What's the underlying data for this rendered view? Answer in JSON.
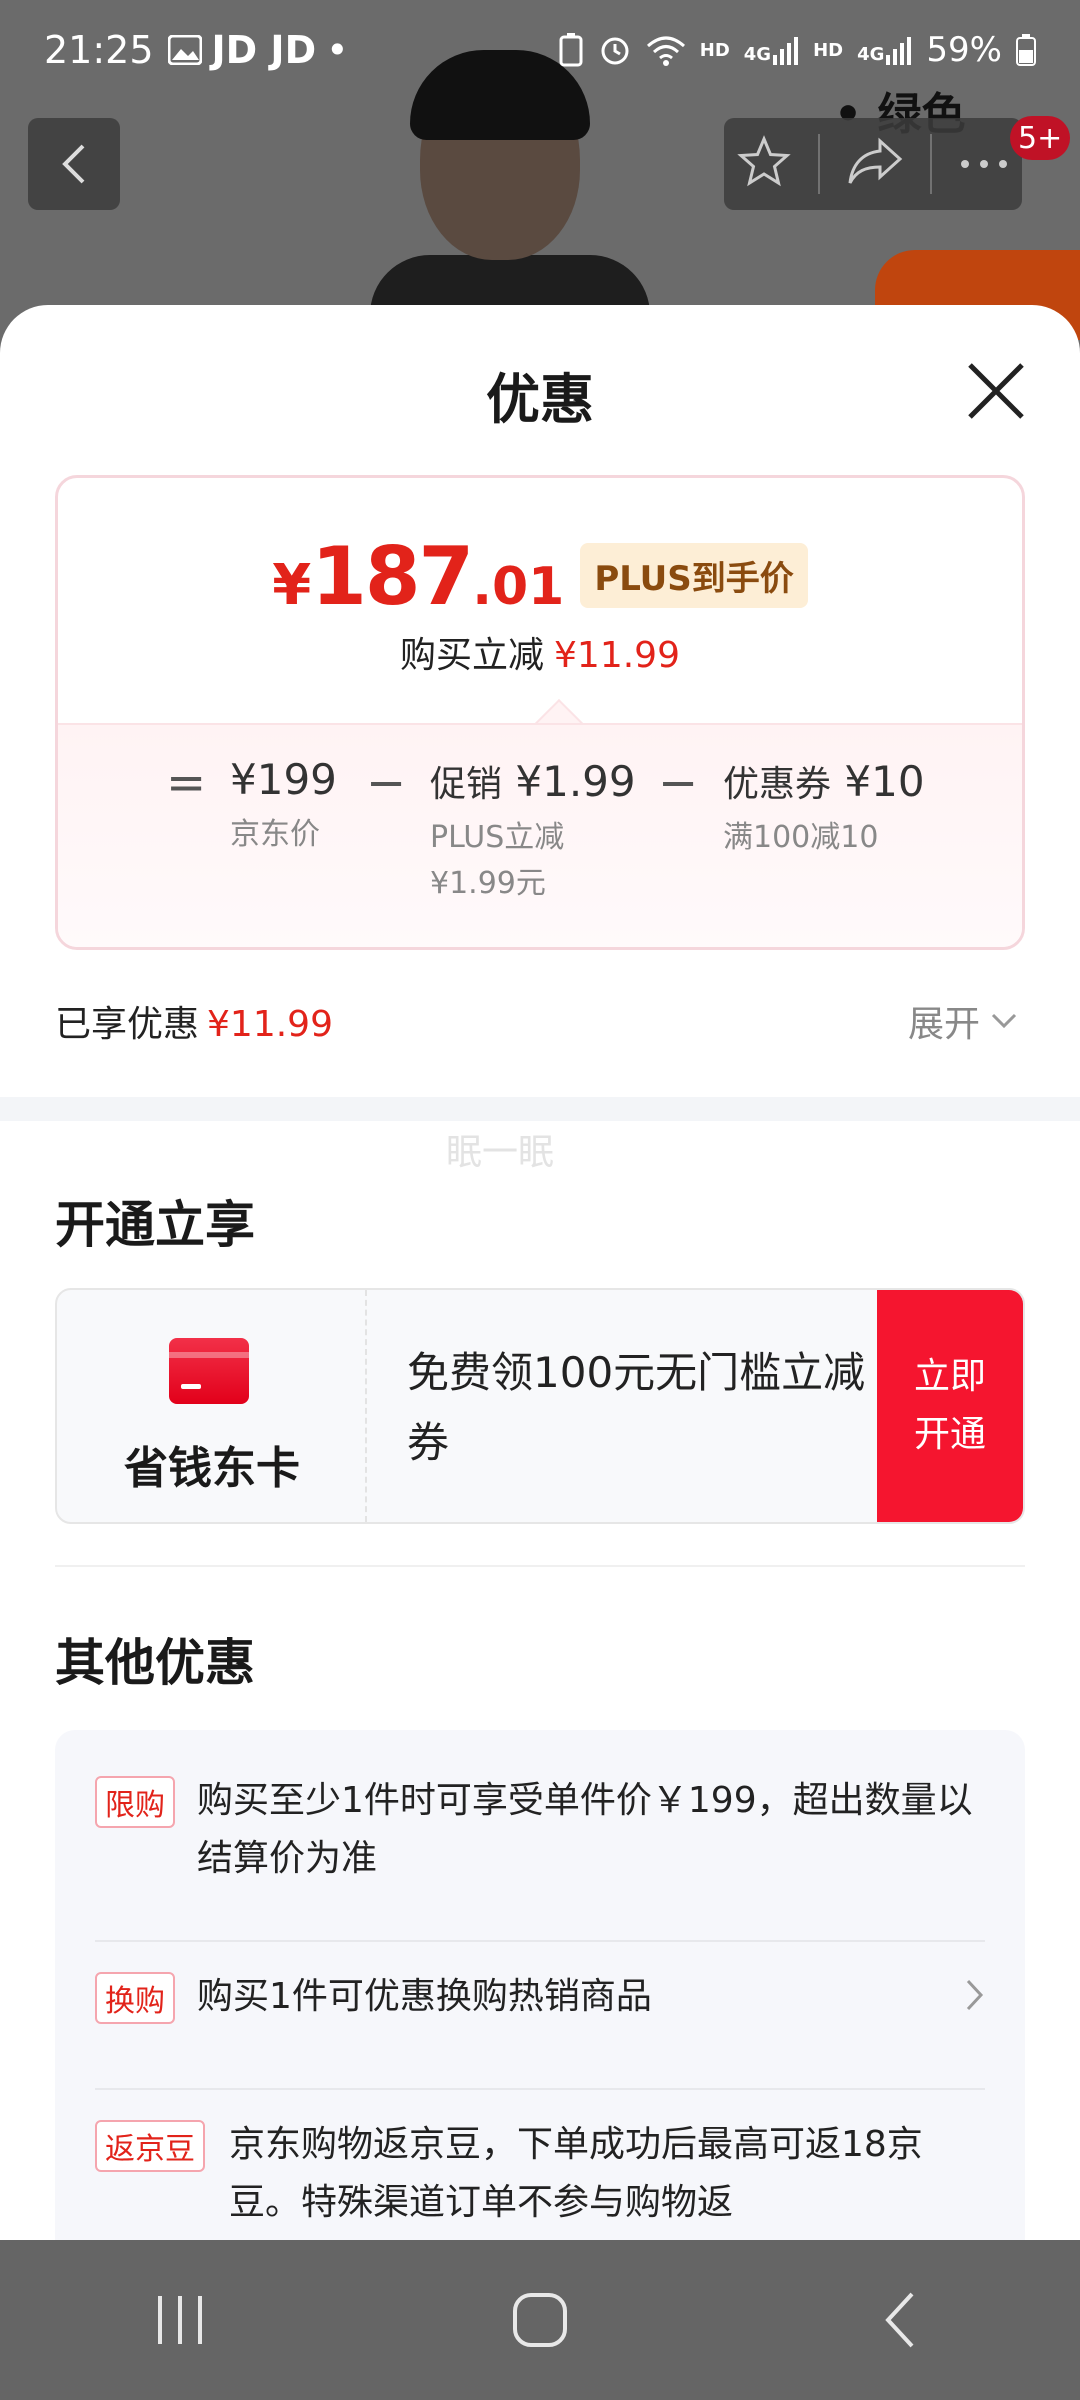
{
  "status_bar": {
    "time": "21:25",
    "notif_text": "JD JD",
    "dot": "•",
    "hd1": "HD",
    "sig1": "4G",
    "hd2": "HD",
    "sig2": "4G",
    "battery": "59%"
  },
  "background": {
    "variant_label": "• 绿色",
    "cart_badge": "5+"
  },
  "sheet": {
    "title": "优惠",
    "price": {
      "currency": "¥",
      "integer": "187",
      "decimal": ".01",
      "tag": "PLUS到手价",
      "reduce_label": "购买立减",
      "reduce_amount": "¥11.99"
    },
    "breakdown": {
      "eq": "=",
      "minus": "−",
      "jd_price": "¥199",
      "jd_price_label": "京东价",
      "promo_label": "促销",
      "promo_value": "¥1.99",
      "promo_sub1": "PLUS立减",
      "promo_sub2": "¥1.99元",
      "coupon_label": "优惠券",
      "coupon_value": "¥10",
      "coupon_sub": "满100减10"
    },
    "enjoyed": {
      "label": "已享优惠",
      "amount": "¥11.99",
      "expand": "展开"
    },
    "watermark": "眠一眠",
    "open_section": {
      "title": "开通立享",
      "card_name": "省钱东卡",
      "desc": "免费领100元无门槛立减券",
      "button": "立即开通"
    },
    "other_section": {
      "title": "其他优惠",
      "items": [
        {
          "tag": "限购",
          "text": "购买至少1件时可享受单件价￥199，超出数量以结算价为准"
        },
        {
          "tag": "换购",
          "text": "购买1件可优惠换购热销商品"
        },
        {
          "tag": "返京豆",
          "text": "京东购物返京豆，下单成功后最高可返18京豆。特殊渠道订单不参与购物返"
        }
      ]
    }
  },
  "icons": {
    "back": "chevron-left-icon",
    "favorite": "star-icon",
    "share": "share-icon",
    "more": "more-icon",
    "close": "close-icon",
    "expand": "chevron-down-icon",
    "nav_recent": "recent-apps-icon",
    "nav_home": "home-icon",
    "nav_back": "back-icon"
  },
  "colors": {
    "accent_red": "#e2231a",
    "button_red": "#f5152f",
    "plus_tag_bg": "#fdeed6"
  }
}
